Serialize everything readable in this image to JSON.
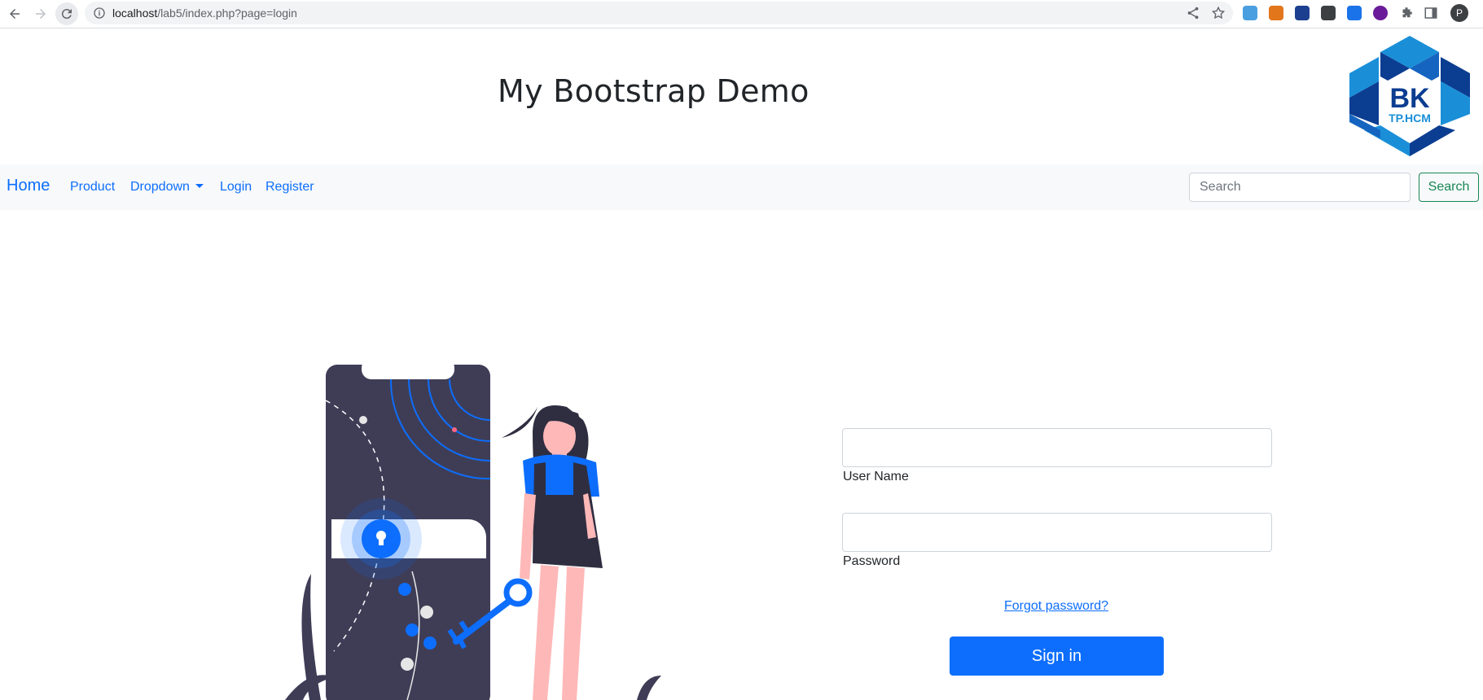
{
  "browser": {
    "url_host": "localhost",
    "url_path": "/lab5/index.php?page=login",
    "profile_initial": "P"
  },
  "header": {
    "title": "My Bootstrap Demo",
    "logo_text_main": "BK",
    "logo_text_sub": "TP.HCM"
  },
  "navbar": {
    "brand": "Home",
    "links": [
      "Product",
      "Dropdown",
      "Login",
      "Register"
    ],
    "search_placeholder": "Search",
    "search_button": "Search"
  },
  "login": {
    "username_label": "User Name",
    "password_label": "Password",
    "forgot_link": "Forgot password?",
    "signin_button": "Sign in"
  },
  "colors": {
    "primary": "#0d6efd",
    "success": "#198754",
    "navbar_bg": "#f8f9fa",
    "logo_blue": "#0b3d91",
    "logo_light": "#1a8fd8"
  }
}
